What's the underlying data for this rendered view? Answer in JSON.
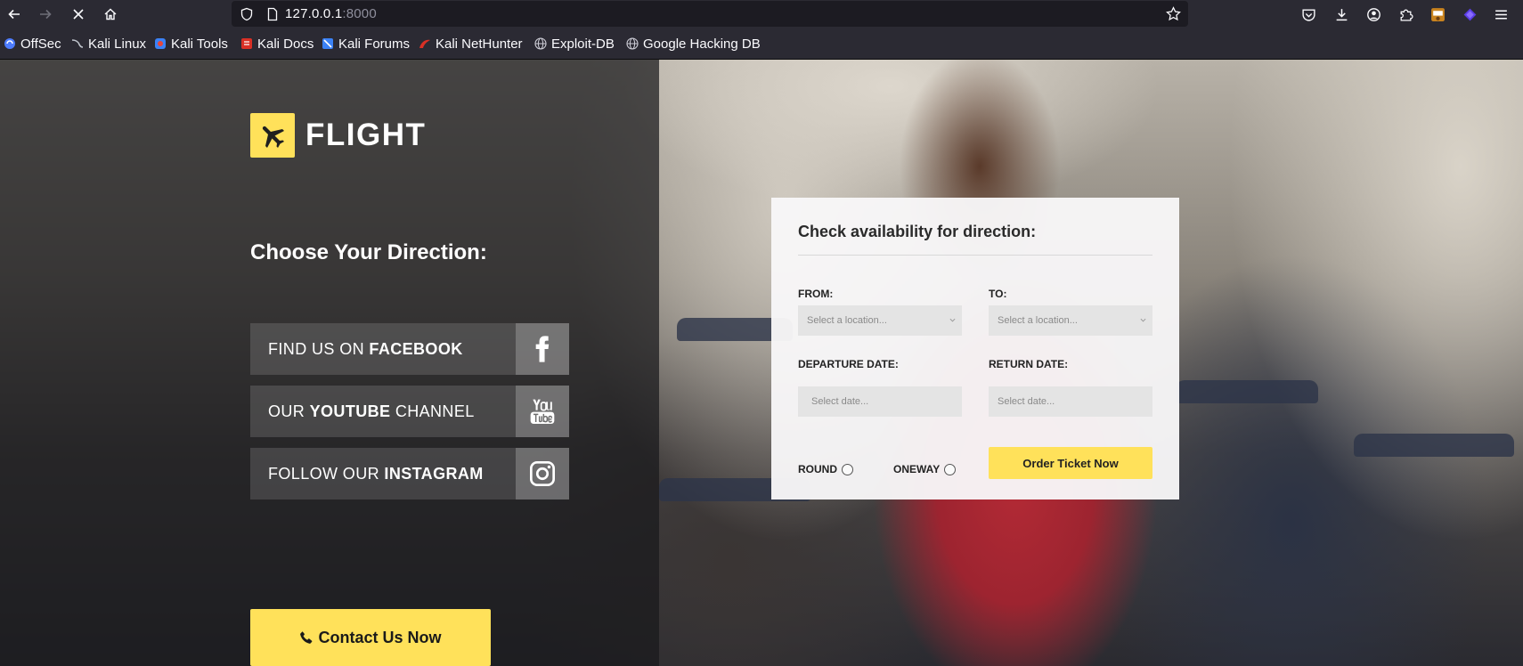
{
  "browser": {
    "url_host": "127.0.0.1",
    "url_port": ":8000",
    "bookmarks": [
      {
        "label": "OffSec",
        "icon": "offsec-icon",
        "color": "#4d7cfe"
      },
      {
        "label": "Kali Linux",
        "icon": "kali-dragon-icon",
        "color": "#9aa0a6"
      },
      {
        "label": "Kali Tools",
        "icon": "kali-tools-icon",
        "color": "#e8463a"
      },
      {
        "label": "Kali Docs",
        "icon": "kali-docs-icon",
        "color": "#d93025"
      },
      {
        "label": "Kali Forums",
        "icon": "kali-forums-icon",
        "color": "#3b82f6"
      },
      {
        "label": "Kali NetHunter",
        "icon": "nethunter-icon",
        "color": "#d93025"
      },
      {
        "label": "Exploit-DB",
        "icon": "globe-icon",
        "color": "#cfcfd8"
      },
      {
        "label": "Google Hacking DB",
        "icon": "globe-icon",
        "color": "#cfcfd8"
      }
    ]
  },
  "site": {
    "logo_text": "FLIGHT",
    "direction_title": "Choose Your Direction:",
    "social": [
      {
        "pre": "FIND US ON ",
        "bold": "FACEBOOK",
        "post": "",
        "icon": "facebook-icon"
      },
      {
        "pre": "OUR ",
        "bold": "YOUTUBE",
        "post": " CHANNEL",
        "icon": "youtube-icon"
      },
      {
        "pre": "FOLLOW OUR ",
        "bold": "INSTAGRAM",
        "post": "",
        "icon": "instagram-icon"
      }
    ],
    "contact_label": "Contact Us Now",
    "accent_color": "#ffe15a"
  },
  "form": {
    "title": "Check availability for direction:",
    "from_label": "FROM:",
    "to_label": "TO:",
    "location_placeholder": "Select a location...",
    "departure_label": "DEPARTURE DATE:",
    "return_label": "RETURN DATE:",
    "date_placeholder": "Select date...",
    "round_label": "ROUND",
    "oneway_label": "ONEWAY",
    "order_label": "Order Ticket Now"
  }
}
